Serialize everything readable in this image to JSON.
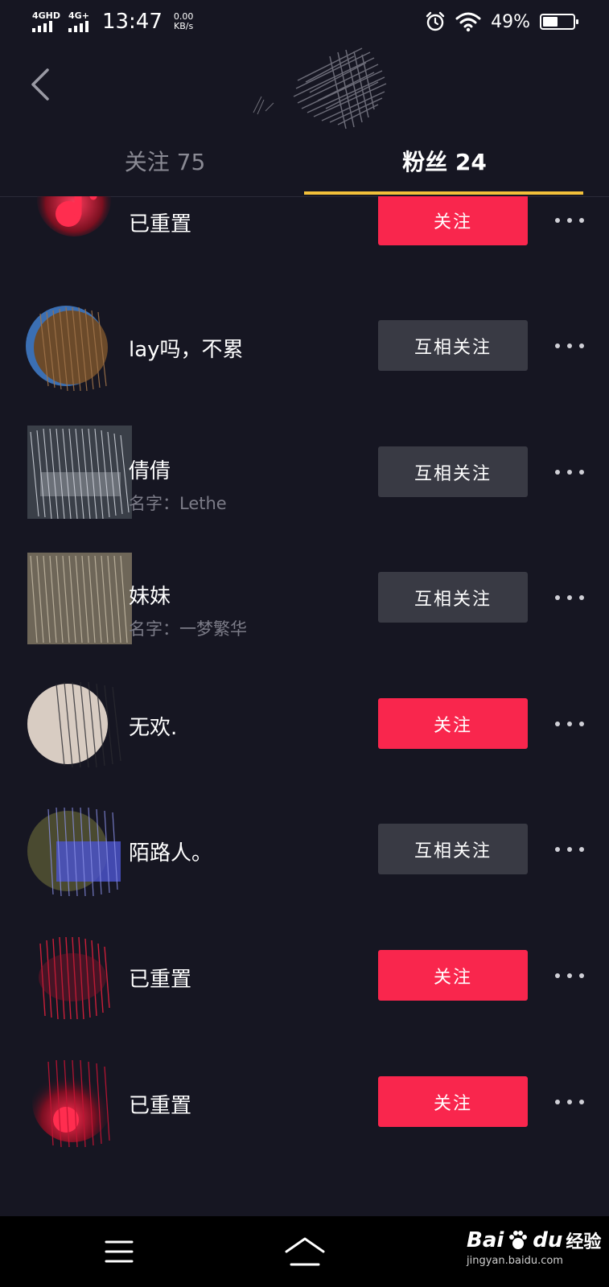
{
  "status_bar": {
    "network_1": "4GHD",
    "network_2": "4G+",
    "time": "13:47",
    "speed_value": "0.00",
    "speed_unit": "KB/s",
    "battery_percent": "49%",
    "battery_level": 0.49
  },
  "header": {
    "back_icon": "chevron-left-icon"
  },
  "tabs": [
    {
      "label": "关注 75"
    },
    {
      "label": "粉丝 24"
    }
  ],
  "fans": [
    {
      "name": "已重置",
      "subtitle": "",
      "button": "关注",
      "button_type": "follow",
      "avatar": "music-note"
    },
    {
      "name": "lay吗，不累",
      "subtitle": "",
      "button": "互相关注",
      "button_type": "mutual",
      "avatar": "photo-brown"
    },
    {
      "name": "倩倩",
      "subtitle": "名字：Lethe",
      "button": "互相关注",
      "button_type": "mutual",
      "avatar": "photo-gray"
    },
    {
      "name": "妹妹",
      "subtitle": "名字：一梦繁华",
      "button": "互相关注",
      "button_type": "mutual",
      "avatar": "photo-beige"
    },
    {
      "name": "无欢.",
      "subtitle": "",
      "button": "关注",
      "button_type": "follow",
      "avatar": "photo-light"
    },
    {
      "name": "陌路人。",
      "subtitle": "",
      "button": "互相关注",
      "button_type": "mutual",
      "avatar": "photo-blue"
    },
    {
      "name": "已重置",
      "subtitle": "",
      "button": "关注",
      "button_type": "follow",
      "avatar": "red-scribble"
    },
    {
      "name": "已重置",
      "subtitle": "",
      "button": "关注",
      "button_type": "follow",
      "avatar": "music-note-scribble"
    }
  ],
  "bottom_nav": {
    "menu_icon": "menu-icon",
    "home_icon": "home-icon"
  },
  "watermark": {
    "brand": "Bai",
    "brand_du": "du",
    "brand_cn": "经验",
    "url": "jingyan.baidu.com"
  }
}
